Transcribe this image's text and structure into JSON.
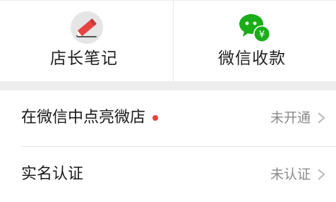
{
  "grid": {
    "items": [
      {
        "label": "店长笔记",
        "icon": "pencil-note-icon",
        "icon_bg": "#e5e5e5",
        "accent": "#e64340"
      },
      {
        "label": "微信收款",
        "icon": "wechat-pay-icon",
        "icon_color": "#1aad19",
        "symbol": "¥"
      }
    ]
  },
  "list": {
    "items": [
      {
        "title": "在微信中点亮微店",
        "status": "未开通",
        "has_dot": true
      },
      {
        "title": "实名认证",
        "status": "未认证",
        "has_dot": false
      }
    ]
  },
  "colors": {
    "dot": "#e64340",
    "status_text": "#8a8a8a",
    "band": "#ededed"
  }
}
